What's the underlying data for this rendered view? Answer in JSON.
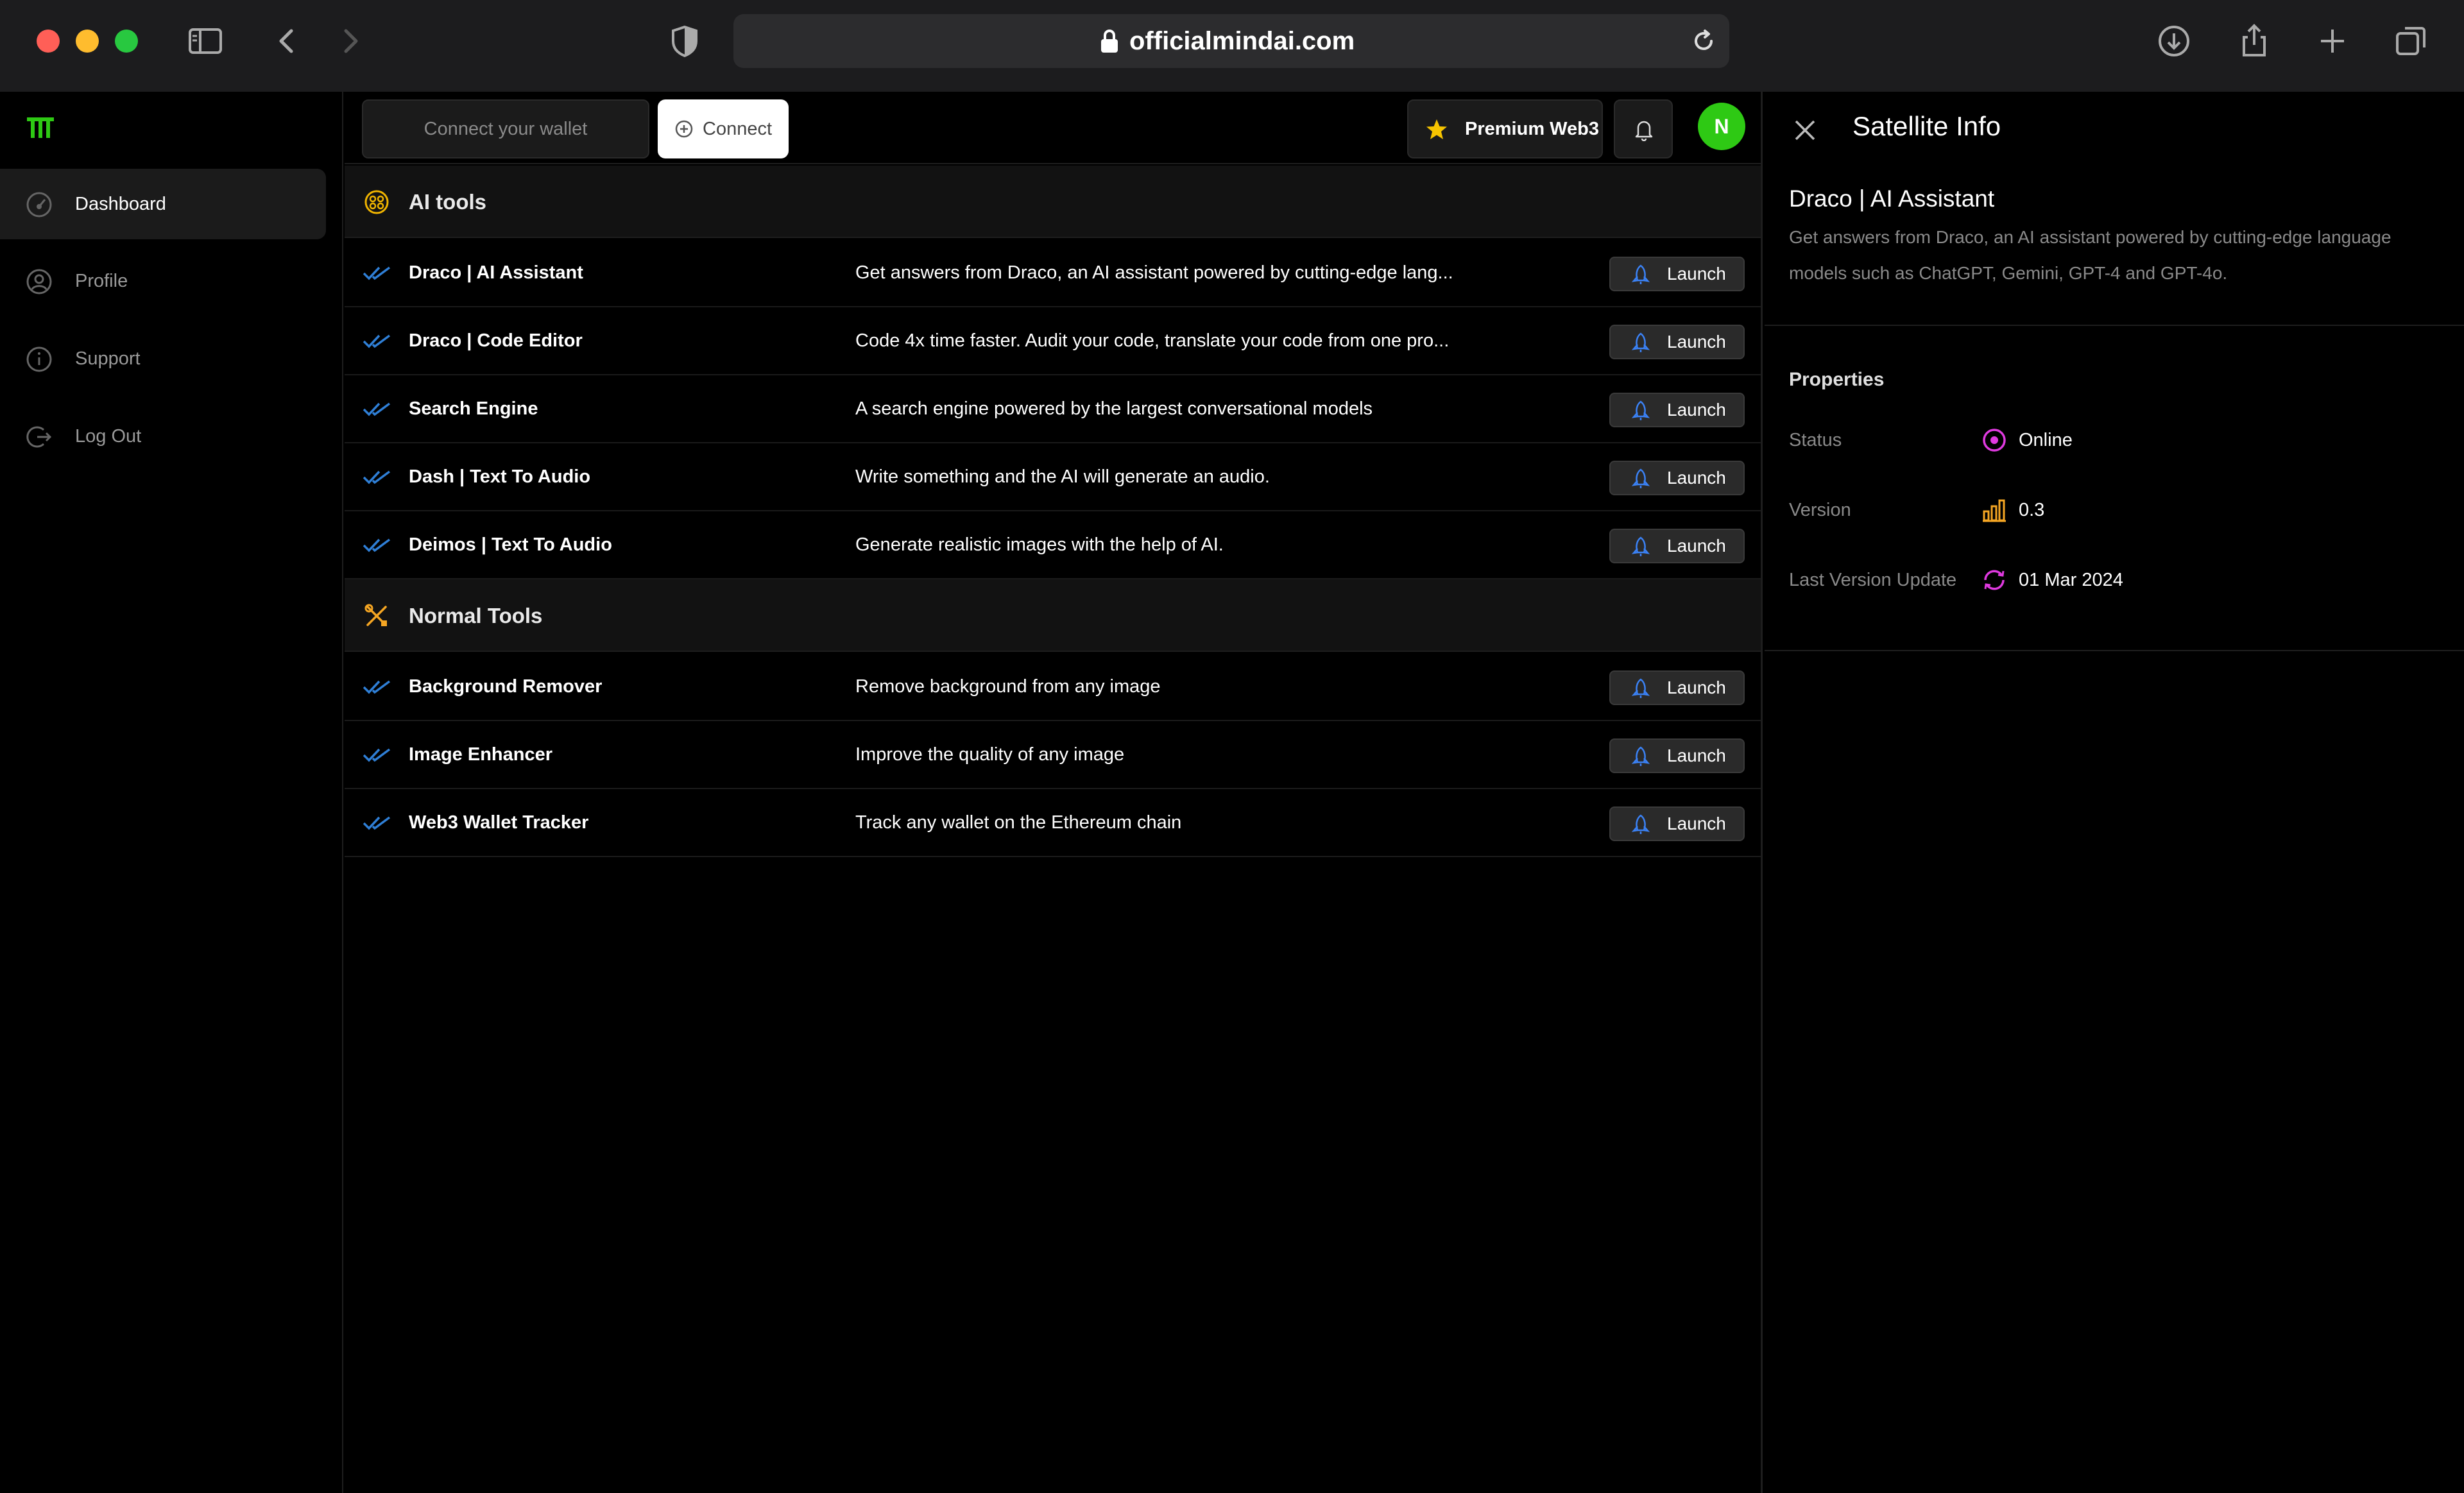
{
  "browser": {
    "url": "officialmindai.com"
  },
  "sidebar": {
    "items": [
      {
        "label": "Dashboard",
        "icon": "gauge-icon",
        "active": true
      },
      {
        "label": "Profile",
        "icon": "user-icon",
        "active": false
      },
      {
        "label": "Support",
        "icon": "info-icon",
        "active": false
      },
      {
        "label": "Log Out",
        "icon": "logout-icon",
        "active": false
      }
    ]
  },
  "topbar": {
    "wallet_placeholder": "Connect your wallet",
    "connect_label": "Connect",
    "premium_label": "Premium Web3",
    "avatar_initial": "N"
  },
  "sections": [
    {
      "title": "AI tools",
      "icon": "brain-icon",
      "tools": [
        {
          "name": "Draco | AI Assistant",
          "description": "Get answers from Draco, an AI assistant powered by cutting-edge lang..."
        },
        {
          "name": "Draco | Code Editor",
          "description": "Code 4x time faster. Audit your code, translate your code from one pro..."
        },
        {
          "name": "Search Engine",
          "description": "A search engine powered by the largest conversational models"
        },
        {
          "name": "Dash | Text To Audio",
          "description": "Write something and the AI will generate an audio."
        },
        {
          "name": "Deimos | Text To Audio",
          "description": "Generate realistic images with the help of AI."
        }
      ]
    },
    {
      "title": "Normal Tools",
      "icon": "tools-icon",
      "tools": [
        {
          "name": "Background Remover",
          "description": "Remove background from any image"
        },
        {
          "name": "Image Enhancer",
          "description": "Improve the quality of any image"
        },
        {
          "name": "Web3 Wallet Tracker",
          "description": "Track any wallet on the Ethereum chain"
        }
      ]
    }
  ],
  "launch_label": "Launch",
  "panel": {
    "title": "Satellite Info",
    "subtitle": "Draco | AI Assistant",
    "description": "Get answers from Draco, an AI assistant powered by cutting-edge language models such as ChatGPT, Gemini, GPT-4 and GPT-4o.",
    "properties_title": "Properties",
    "properties": [
      {
        "label": "Status",
        "value": "Online",
        "icon": "status-dot-icon"
      },
      {
        "label": "Version",
        "value": "0.3",
        "icon": "bar-chart-icon"
      },
      {
        "label": "Last Version Update",
        "value": "01 Mar 2024",
        "icon": "refresh-icon"
      }
    ]
  },
  "colors": {
    "accent_green": "#2ec914",
    "check_blue": "#2f7fd6",
    "star_yellow": "#f6c400",
    "ai_icon_yellow": "#f0b400",
    "tools_icon_orange": "#f5a623",
    "status_magenta": "#e03ae0",
    "version_orange": "#f5a623"
  }
}
